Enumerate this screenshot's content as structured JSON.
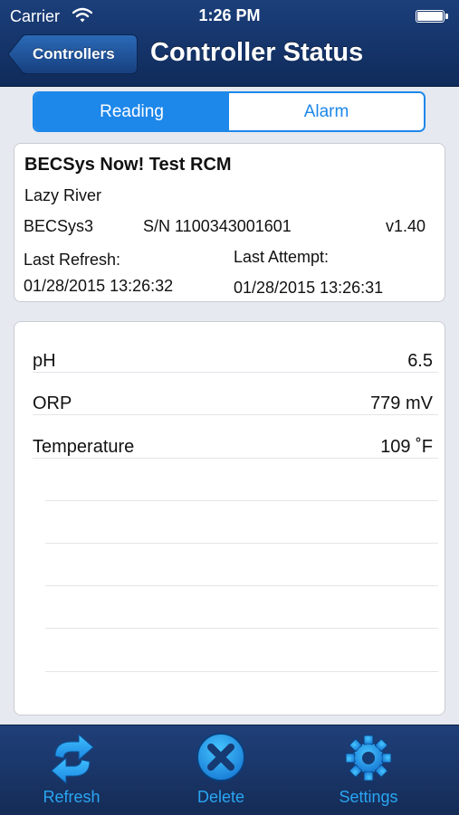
{
  "status_bar": {
    "carrier": "Carrier",
    "time": "1:26 PM"
  },
  "nav": {
    "back_label": "Controllers",
    "title": "Controller Status"
  },
  "segmented": {
    "tabs": [
      {
        "label": "Reading",
        "selected": true
      },
      {
        "label": "Alarm",
        "selected": false
      }
    ]
  },
  "controller": {
    "name": "BECSys Now! Test RCM",
    "site": "Lazy River",
    "model": "BECSys3",
    "serial": "S/N 1100343001601",
    "version": "v1.40",
    "last_refresh_label": "Last Refresh:",
    "last_refresh_value": "01/28/2015 13:26:32",
    "last_attempt_label": "Last Attempt:",
    "last_attempt_value": "01/28/2015 13:26:31"
  },
  "readings": [
    {
      "label": "pH",
      "value": "6.5"
    },
    {
      "label": "ORP",
      "value": "779 mV"
    },
    {
      "label": "Temperature",
      "value": "109 ˚F"
    }
  ],
  "toolbar": {
    "refresh_label": "Refresh",
    "delete_label": "Delete",
    "settings_label": "Settings",
    "icons": [
      "refresh-icon",
      "delete-icon",
      "settings-icon"
    ]
  },
  "colors": {
    "nav_bar": "#16366d",
    "accent": "#1d87ea",
    "toolbar_label": "#2aa6f3",
    "background": "#e6e9ef"
  }
}
